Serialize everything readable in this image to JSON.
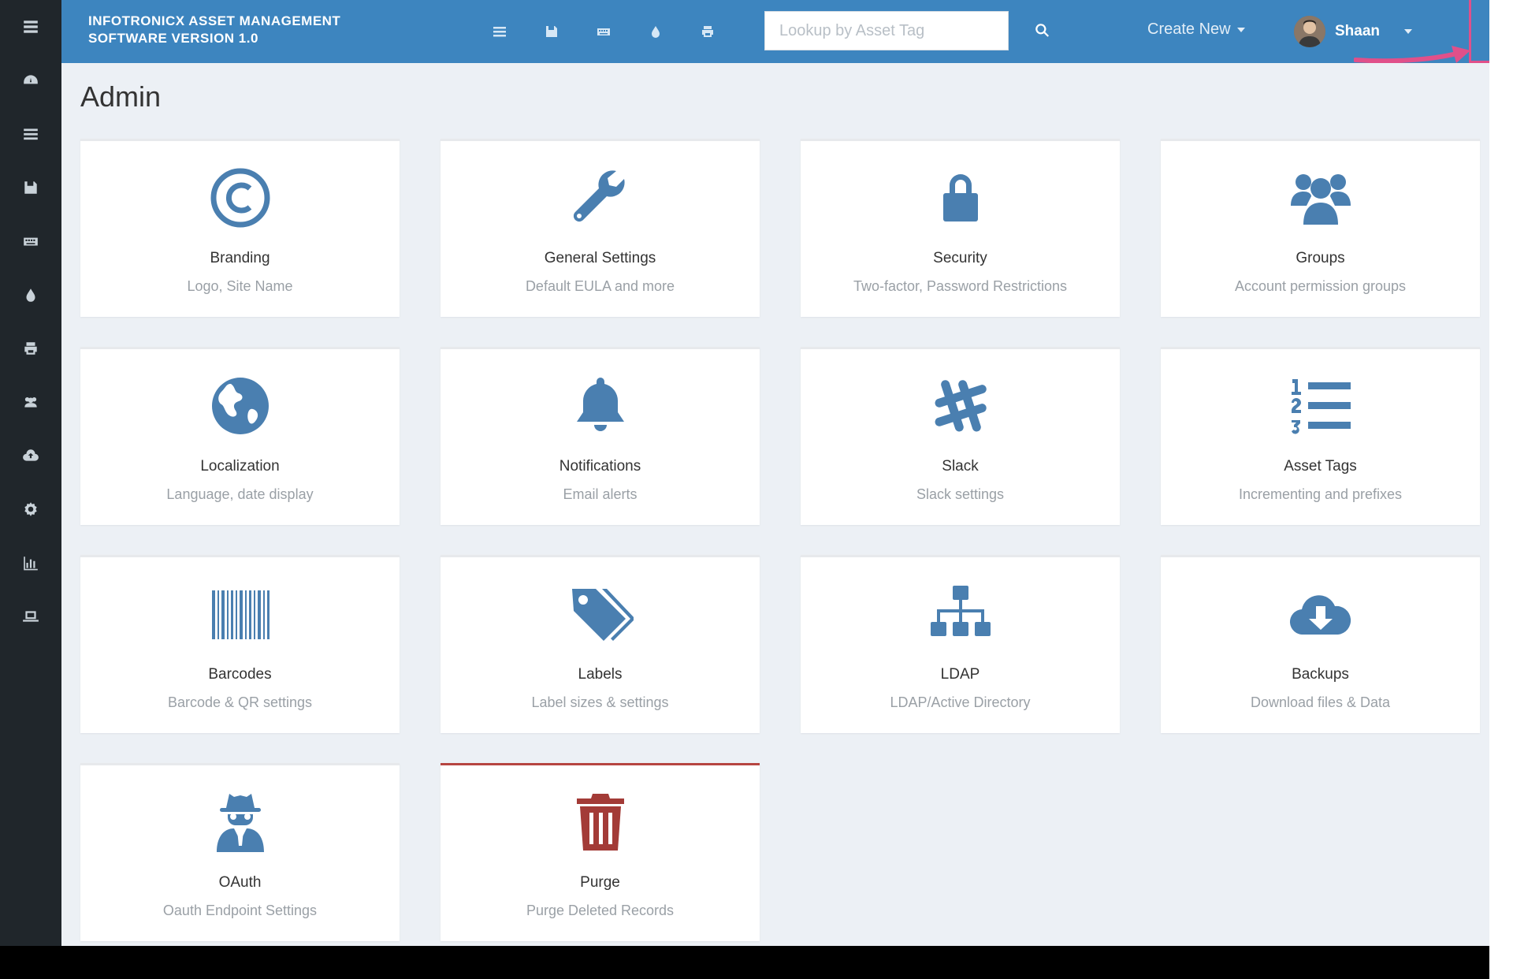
{
  "header": {
    "app_title": "INFOTRONICX ASSET MANAGEMENT SOFTWARE Version 1.0",
    "search_placeholder": "Lookup by Asset Tag",
    "create_new_label": "Create New",
    "user_name": "Shaan",
    "icons": [
      "list-icon",
      "save-icon",
      "keyboard-icon",
      "drop-icon",
      "printer-icon"
    ]
  },
  "sidebar": {
    "icons": [
      "menu-icon",
      "dashboard-icon",
      "list-icon",
      "save-icon",
      "keyboard-icon",
      "drop-icon",
      "printer-icon",
      "users-icon",
      "cloud-upload-icon",
      "gear-icon",
      "chart-icon",
      "laptop-icon"
    ]
  },
  "page": {
    "title": "Admin"
  },
  "colors": {
    "primary": "#3d85bf",
    "icon_blue": "#4a7fb0",
    "danger": "#a33b37",
    "background": "#ecf0f5",
    "sidebar": "#20262b",
    "highlight": "#e0508a"
  },
  "cards": [
    {
      "title": "Branding",
      "subtitle": "Logo, Site Name",
      "icon": "copyright-icon"
    },
    {
      "title": "General Settings",
      "subtitle": "Default EULA and more",
      "icon": "wrench-icon"
    },
    {
      "title": "Security",
      "subtitle": "Two-factor, Password Restrictions",
      "icon": "lock-icon"
    },
    {
      "title": "Groups",
      "subtitle": "Account permission groups",
      "icon": "groups-icon"
    },
    {
      "title": "Localization",
      "subtitle": "Language, date display",
      "icon": "globe-icon"
    },
    {
      "title": "Notifications",
      "subtitle": "Email alerts",
      "icon": "bell-icon"
    },
    {
      "title": "Slack",
      "subtitle": "Slack settings",
      "icon": "slack-icon"
    },
    {
      "title": "Asset Tags",
      "subtitle": "Incrementing and prefixes",
      "icon": "ordered-list-icon"
    },
    {
      "title": "Barcodes",
      "subtitle": "Barcode & QR settings",
      "icon": "barcode-icon"
    },
    {
      "title": "Labels",
      "subtitle": "Label sizes & settings",
      "icon": "tags-icon"
    },
    {
      "title": "LDAP",
      "subtitle": "LDAP/Active Directory",
      "icon": "sitemap-icon"
    },
    {
      "title": "Backups",
      "subtitle": "Download files & Data",
      "icon": "cloud-download-icon"
    },
    {
      "title": "OAuth",
      "subtitle": "Oauth Endpoint Settings",
      "icon": "spy-icon"
    },
    {
      "title": "Purge",
      "subtitle": "Purge Deleted Records",
      "icon": "trash-icon"
    }
  ]
}
